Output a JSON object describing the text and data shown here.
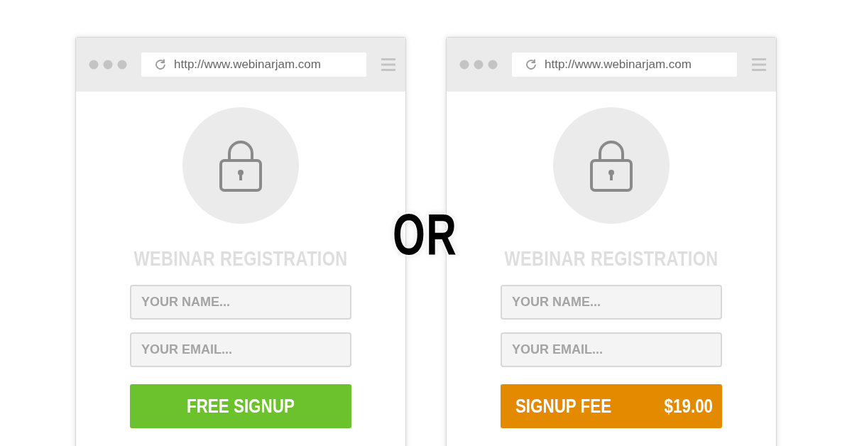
{
  "windows": [
    {
      "url": "http://www.webinarjam.com",
      "title": "WEBINAR REGISTRATION",
      "fields": [
        {
          "placeholder": "YOUR NAME..."
        },
        {
          "placeholder": "YOUR EMAIL..."
        }
      ],
      "button": {
        "kind": "free",
        "label": "FREE SIGNUP"
      }
    },
    {
      "url": "http://www.webinarjam.com",
      "title": "WEBINAR REGISTRATION",
      "fields": [
        {
          "placeholder": "YOUR NAME..."
        },
        {
          "placeholder": "YOUR EMAIL..."
        }
      ],
      "button": {
        "kind": "paid",
        "label": "SIGNUP FEE",
        "price": "$19.00"
      }
    }
  ],
  "divider_text": "OR"
}
